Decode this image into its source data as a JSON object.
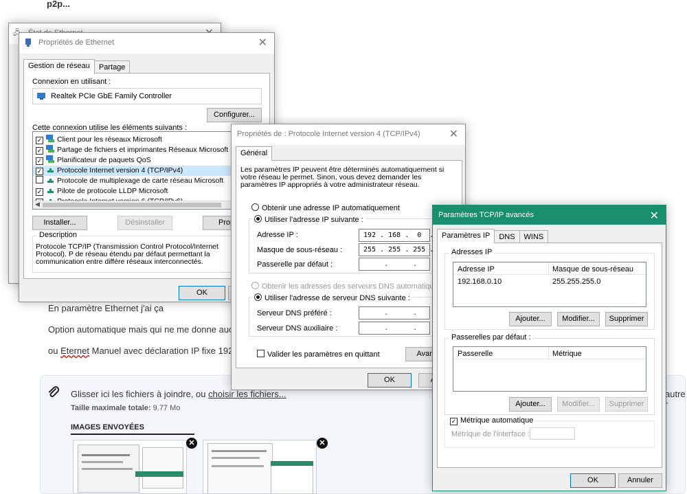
{
  "forum": {
    "top_text": "p2p...",
    "line1": "En paramètre Ethernet j'ai ça",
    "line2": "Option automatique mais qui ne me donne aucu",
    "line3_prefix": "ou ",
    "line3_word": "Eternet",
    "line3_rest": " Manuel avec déclaration IP fixe 192.1",
    "attach_text": "Glisser ici les fichiers à joindre, ou ",
    "attach_link": "choisir les fichiers...",
    "attach_right": "autre r",
    "max_size_label": "Taille maximale totale:",
    "max_size_value": "9.77 Mo",
    "sent_images": "IMAGES ENVOYÉES"
  },
  "etat": {
    "title": "État de Ethernet"
  },
  "props_eth": {
    "title": "Propriétés de Ethernet",
    "tabs": [
      "Gestion de réseau",
      "Partage"
    ],
    "connect_using": "Connexion en utilisant :",
    "adapter": "Realtek PCIe GbE Family Controller",
    "configure": "Configurer...",
    "items_label": "Cette connexion utilise les éléments suivants :",
    "items": [
      {
        "label": "Client pour les réseaux Microsoft",
        "checked": true
      },
      {
        "label": "Partage de fichiers et imprimantes Réseaux Microsoft",
        "checked": true
      },
      {
        "label": "Planificateur de paquets QoS",
        "checked": true
      },
      {
        "label": "Protocole Internet version 4 (TCP/IPv4)",
        "checked": true
      },
      {
        "label": "Protocole de multiplexage de carte réseau Microsoft",
        "checked": false
      },
      {
        "label": "Pilote de protocole LLDP Microsoft",
        "checked": true
      },
      {
        "label": "Protocole Internet version 6 (TCP/IPv6)",
        "checked": true
      }
    ],
    "install": "Installer...",
    "uninstall": "Désinstaller",
    "properties": "Propr",
    "description_label": "Description",
    "description": "Protocole TCP/IP (Transmission Control Protocol/Internet Protocol). P de réseau étendu par défaut permettant la communication entre différe réseaux interconnectés.",
    "ok": "OK"
  },
  "props_ipv4": {
    "title": "Propriétés de : Protocole Internet version 4 (TCP/IPv4)",
    "tab": "Général",
    "intro": "Les paramètres IP peuvent être déterminés automatiquement si votre réseau le permet. Sinon, vous devez demander les paramètres IP appropriés à votre administrateur réseau.",
    "auto_ip": "Obtenir une adresse IP automatiquement",
    "use_ip": "Utiliser l'adresse IP suivante :",
    "ip_label": "Adresse IP :",
    "ip_value": "192 . 168 .  0  . 10",
    "mask_label": "Masque de sous-réseau :",
    "mask_value": "255 . 255 . 255 .  0",
    "gw_label": "Passerelle par défaut :",
    "gw_value": "     .      .      .",
    "auto_dns": "Obtenir les adresses des serveurs DNS automatiquement",
    "use_dns": "Utiliser l'adresse de serveur DNS suivante :",
    "dns1_label": "Serveur DNS préféré :",
    "dns1_value": "     .      .      .",
    "dns2_label": "Serveur DNS auxiliaire :",
    "dns2_value": "     .      .      .",
    "validate": "Valider les paramètres en quittant",
    "advanced": "Avancé",
    "ok": "OK",
    "cancel": "A"
  },
  "advanced": {
    "title": "Paramètres TCP/IP avancés",
    "tabs": [
      "Paramètres IP",
      "DNS",
      "WINS"
    ],
    "ip_group": "Adresses IP",
    "col_ip": "Adresse IP",
    "col_mask": "Masque de sous-réseau",
    "row_ip": "192.168.0.10",
    "row_mask": "255.255.255.0",
    "add": "Ajouter...",
    "modify": "Modifier...",
    "delete": "Supprimer",
    "gw_group": "Passerelles par défaut :",
    "col_gw": "Passerelle",
    "col_metric": "Métrique",
    "auto_metric": "Métrique automatique",
    "iface_metric": "Métrique de l'interface :",
    "ok": "OK",
    "cancel": "Annuler"
  },
  "colors": {
    "title_accent": "#1a8f6e",
    "default_button_border": "#0078d7"
  }
}
